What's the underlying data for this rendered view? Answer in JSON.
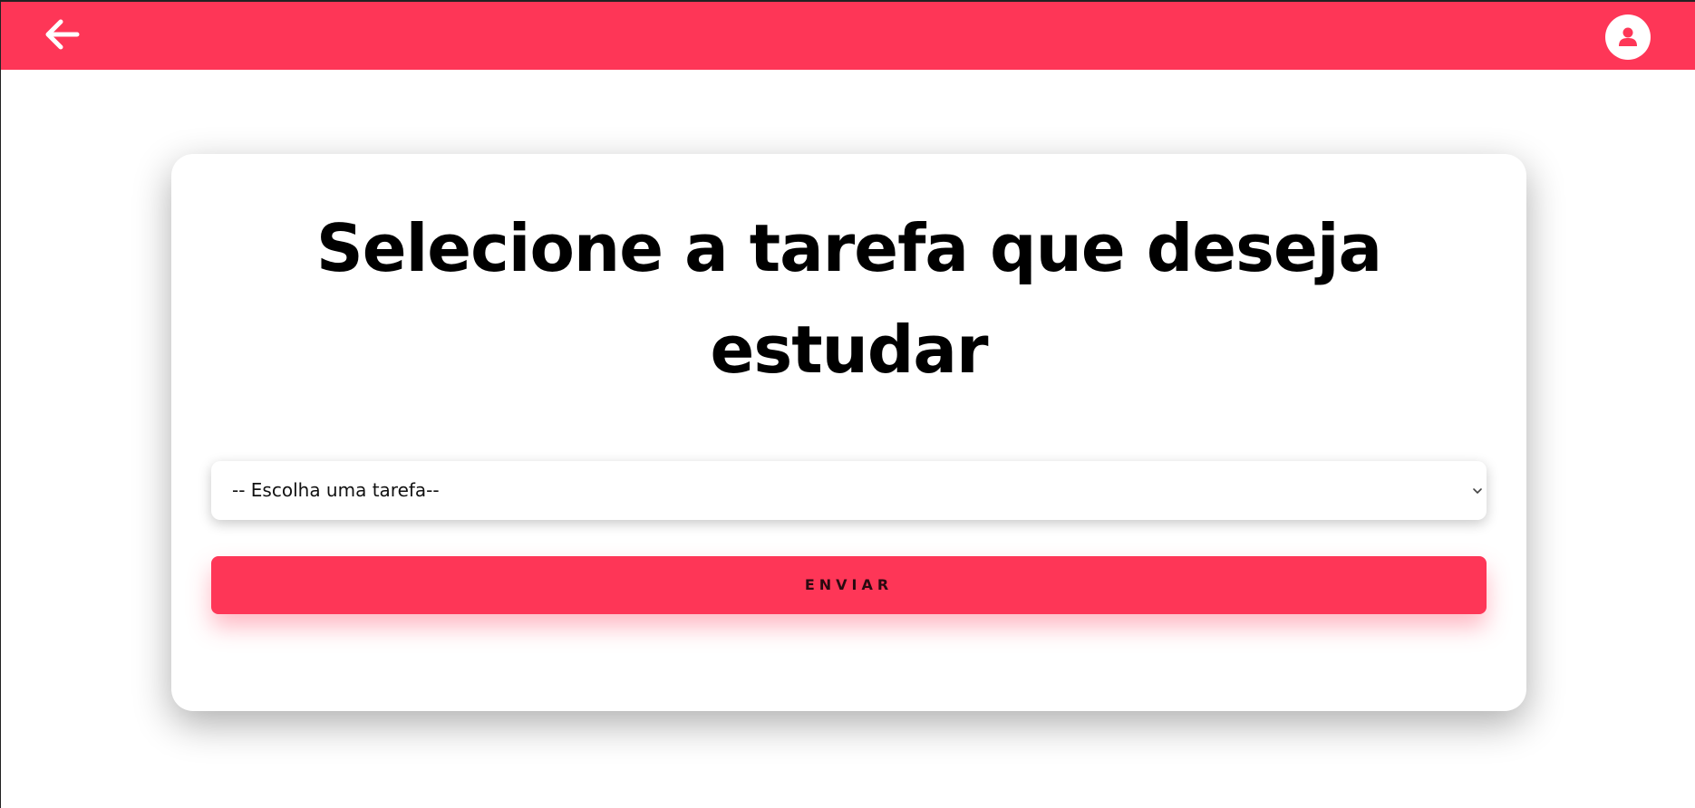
{
  "header": {
    "back_icon": "arrow-left-icon",
    "profile_icon": "user-icon",
    "background_color": "#fe3657"
  },
  "main": {
    "title": "Selecione a tarefa que deseja estudar",
    "task_select": {
      "selected_value": "-- Escolha uma tarefa--",
      "chevron_icon": "chevron-down-icon"
    },
    "submit_label": "ENVIAR"
  },
  "colors": {
    "accent": "#fe3657",
    "text": "#000000",
    "card": "#ffffff"
  }
}
